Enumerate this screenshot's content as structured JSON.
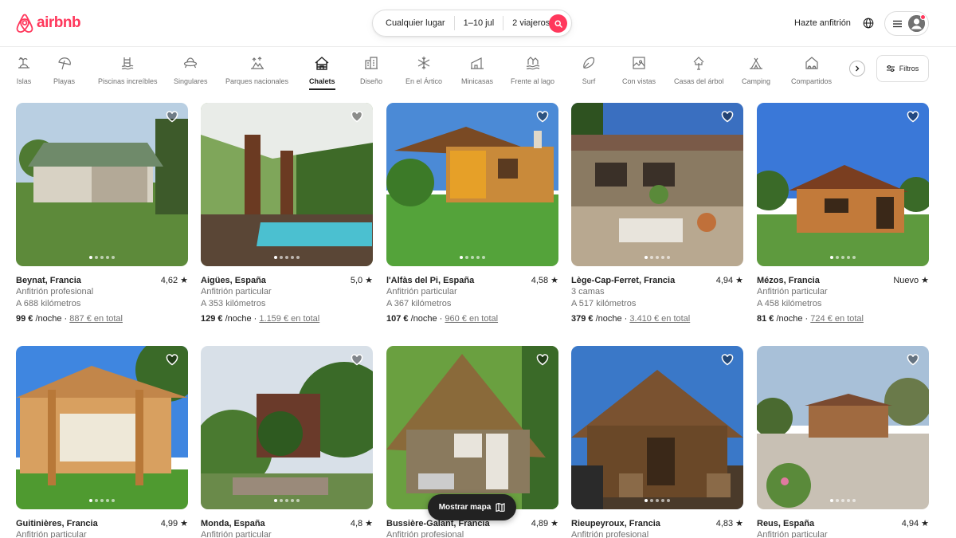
{
  "header": {
    "logo_text": "airbnb",
    "search": {
      "where": "Cualquier lugar",
      "when": "1–10 jul",
      "who": "2 viajeros"
    },
    "host_link": "Hazte anfitrión"
  },
  "categories": [
    {
      "label": "Islas",
      "icon": "island-icon",
      "active": false
    },
    {
      "label": "Playas",
      "icon": "beach-umbrella-icon",
      "active": false
    },
    {
      "label": "Piscinas increíbles",
      "icon": "pool-icon",
      "active": false
    },
    {
      "label": "Singulares",
      "icon": "ufo-icon",
      "active": false
    },
    {
      "label": "Parques nacionales",
      "icon": "national-park-icon",
      "active": false
    },
    {
      "label": "Chalets",
      "icon": "cabin-icon",
      "active": true
    },
    {
      "label": "Diseño",
      "icon": "design-icon",
      "active": false
    },
    {
      "label": "En el Ártico",
      "icon": "snowflake-icon",
      "active": false
    },
    {
      "label": "Minicasas",
      "icon": "tiny-house-icon",
      "active": false
    },
    {
      "label": "Frente al lago",
      "icon": "lake-icon",
      "active": false
    },
    {
      "label": "Surf",
      "icon": "surfboard-icon",
      "active": false
    },
    {
      "label": "Con vistas",
      "icon": "view-icon",
      "active": false
    },
    {
      "label": "Casas del árbol",
      "icon": "treehouse-icon",
      "active": false
    },
    {
      "label": "Camping",
      "icon": "camping-icon",
      "active": false
    },
    {
      "label": "Compartidos",
      "icon": "shared-home-icon",
      "active": false
    }
  ],
  "filters_label": "Filtros",
  "listings": [
    {
      "location": "Beynat, Francia",
      "rating": "4,62",
      "host": "Anfitrión profesional",
      "distance": "A 688 kilómetros",
      "price": "99 €",
      "per_night": " /noche · ",
      "total": "887 € en total"
    },
    {
      "location": "Aigües, España",
      "rating": "5,0",
      "host": "Anfitrión particular",
      "distance": "A 353 kilómetros",
      "price": "129 €",
      "per_night": " /noche · ",
      "total": "1.159 € en total"
    },
    {
      "location": "l'Alfàs del Pi, España",
      "rating": "4,58",
      "host": "Anfitrión particular",
      "distance": "A 367 kilómetros",
      "price": "107 €",
      "per_night": " /noche · ",
      "total": "960 € en total"
    },
    {
      "location": "Lège-Cap-Ferret, Francia",
      "rating": "4,94",
      "host": "3 camas",
      "distance": "A 517 kilómetros",
      "price": "379 €",
      "per_night": " /noche · ",
      "total": "3.410 € en total"
    },
    {
      "location": "Mézos, Francia",
      "rating": "Nuevo",
      "host": "Anfitrión particular",
      "distance": "A 458 kilómetros",
      "price": "81 €",
      "per_night": " /noche · ",
      "total": "724 € en total"
    },
    {
      "location": "Guitinières, Francia",
      "rating": "4,99",
      "host": "Anfitrión particular"
    },
    {
      "location": "Monda, España",
      "rating": "4,8",
      "host": "Anfitrión particular"
    },
    {
      "location": "Bussière-Galant, Francia",
      "rating": "4,89",
      "host": "Anfitrión profesional"
    },
    {
      "location": "Rieupeyroux, Francia",
      "rating": "4,83",
      "host": "Anfitrión profesional"
    },
    {
      "location": "Reus, España",
      "rating": "4,94",
      "host": "Anfitrión particular"
    }
  ],
  "map_button": "Mostrar mapa",
  "colors": {
    "brand": "#FF385C",
    "text": "#222222",
    "muted": "#717171"
  }
}
